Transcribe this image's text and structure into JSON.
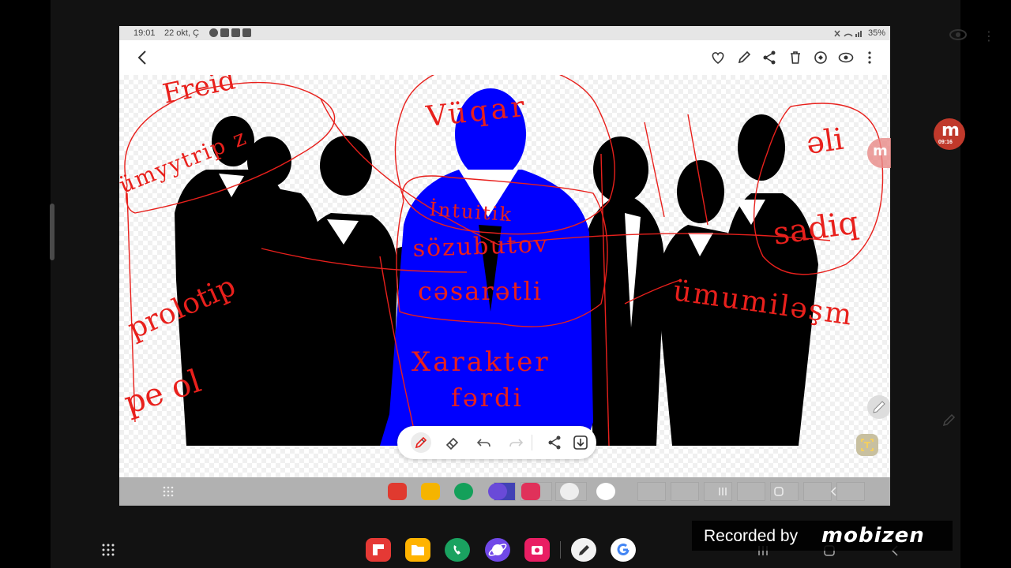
{
  "statusbar": {
    "time": "19:01",
    "date": "22 okt, Ç",
    "battery": "35%"
  },
  "mobizen": {
    "timer": "09:16",
    "recorded_by": "Recorded by",
    "brand": "mobizen"
  },
  "handwriting": {
    "left_circle": [
      "Freid",
      "ümyytrip z"
    ],
    "left_side": [
      "prolotip",
      "pe ol"
    ],
    "center_circle_top": "Vüqar",
    "center_lines": [
      "İntuitik",
      "sözubutov",
      "cəsarətli"
    ],
    "center_bottom": [
      "Xarakter",
      "fərdi"
    ],
    "right_circle": [
      "əli",
      "sadiq"
    ],
    "right_side": "ümumiləşm"
  },
  "colors": {
    "ink": "#e8201c",
    "figure_highlight": "#0000ff",
    "silhouettes": "#000000"
  },
  "icons": {
    "toolbar": [
      "back-icon",
      "heart-icon",
      "edit-icon",
      "share-icon",
      "delete-icon",
      "remaster-icon",
      "view-icon",
      "more-icon"
    ],
    "pen_toolbar": [
      "pen-icon",
      "eraser-icon",
      "undo-icon",
      "redo-icon",
      "share-icon",
      "save-icon"
    ],
    "apps": [
      "flipboard-icon",
      "files-icon",
      "phone-icon",
      "internet-icon",
      "camera-icon",
      "pen-app-icon",
      "google-icon"
    ]
  }
}
